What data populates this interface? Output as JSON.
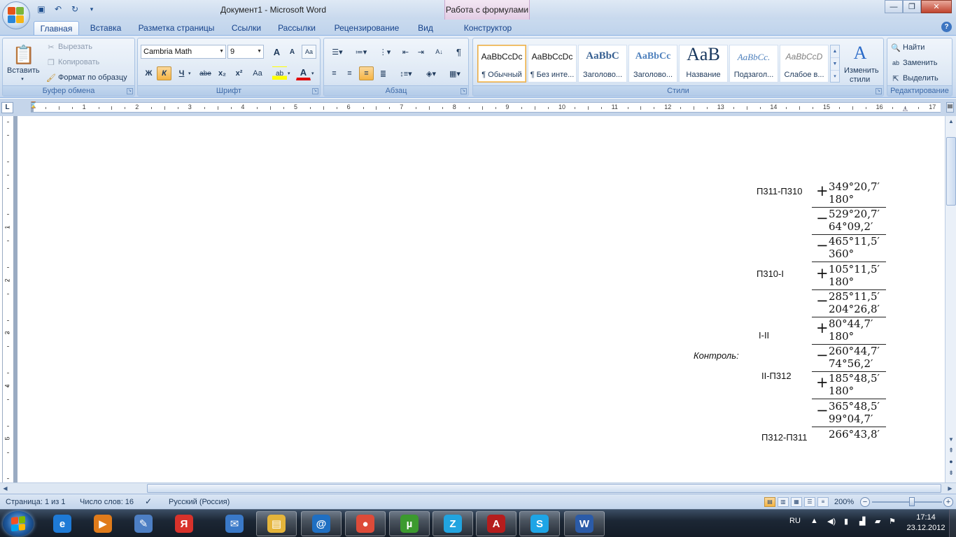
{
  "titlebar": {
    "document_title": "Документ1 - Microsoft Word",
    "context_tab_title": "Работа с формулами",
    "minimize": "—",
    "maximize": "❐",
    "close": "✕"
  },
  "qat": {
    "save_icon": "save-icon",
    "undo_icon": "undo-icon",
    "redo_icon": "redo-icon",
    "customize_icon": "qat-dropdown-icon"
  },
  "tabs": [
    "Главная",
    "Вставка",
    "Разметка страницы",
    "Ссылки",
    "Рассылки",
    "Рецензирование",
    "Вид",
    "Конструктор"
  ],
  "ribbon": {
    "clipboard": {
      "label": "Буфер обмена",
      "paste": "Вставить",
      "cut": "Вырезать",
      "copy": "Копировать",
      "format_painter": "Формат по образцу"
    },
    "font": {
      "label": "Шрифт",
      "font_name": "Cambria Math",
      "font_size": "9",
      "bold": "Ж",
      "italic": "К",
      "underline": "Ч",
      "strike": "abe",
      "subscript": "x₂",
      "superscript": "x²",
      "change_case": "Aa",
      "grow": "A",
      "shrink": "A",
      "highlight": "ab",
      "font_color": "A"
    },
    "paragraph": {
      "label": "Абзац"
    },
    "styles": {
      "label": "Стили",
      "items": [
        {
          "sample": "AaBbCcDc",
          "name": "¶ Обычный"
        },
        {
          "sample": "AaBbCcDc",
          "name": "¶ Без инте..."
        },
        {
          "sample": "AaBbC",
          "name": "Заголово..."
        },
        {
          "sample": "AaBbCc",
          "name": "Заголово..."
        },
        {
          "sample": "AaB",
          "name": "Название"
        },
        {
          "sample": "AaBbCc.",
          "name": "Подзагол..."
        },
        {
          "sample": "AaBbCcD",
          "name": "Слабое в..."
        }
      ],
      "change_styles_1": "Изменить",
      "change_styles_2": "стили"
    },
    "editing": {
      "label": "Редактирование",
      "find": "Найти",
      "replace": "Заменить",
      "select": "Выделить"
    }
  },
  "ruler": {
    "corner": "L",
    "numbers": [
      "1",
      "2",
      "3",
      "4",
      "5",
      "6",
      "7",
      "8",
      "9",
      "10",
      "11",
      "12",
      "13",
      "14",
      "15",
      "16",
      "17"
    ],
    "vnumbers": [
      "1",
      "2",
      "3",
      "4",
      "5"
    ]
  },
  "document": {
    "labels": {
      "p311_p310": "П311-П310",
      "p310_i": "П310-I",
      "i_ii": "I-II",
      "kontrol": "Контроль:",
      "ii_p312": "II-П312",
      "p312_p311": "П312-П311"
    },
    "calc": [
      {
        "op": "+",
        "top": "349°20,7′",
        "bottom": "180°"
      },
      {
        "op": "−",
        "top": "529°20,7′",
        "bottom": "64°09,2′"
      },
      {
        "op": "−",
        "top": "465°11,5′",
        "bottom": "360°"
      },
      {
        "op": "+",
        "top": "105°11,5′",
        "bottom": "180°"
      },
      {
        "op": "−",
        "top": "285°11,5′",
        "bottom": "204°26,8′"
      },
      {
        "op": "+",
        "top": "80°44,7′",
        "bottom": "180°"
      },
      {
        "op": "−",
        "top": "260°44,7′",
        "bottom": "74°56,2′"
      },
      {
        "op": "+",
        "top": "185°48,5′",
        "bottom": "180°"
      },
      {
        "op": "−",
        "top": "365°48,5′",
        "bottom": "99°04,7′"
      }
    ],
    "result": "266°43,8′"
  },
  "statusbar": {
    "page": "Страница: 1 из 1",
    "words": "Число слов: 16",
    "language": "Русский (Россия)",
    "zoom": "200%",
    "zoom_minus": "−",
    "zoom_plus": "+"
  },
  "taskbar": {
    "lang": "RU",
    "time": "17:14",
    "date": "23.12.2012",
    "apps": [
      {
        "name": "ie-icon",
        "glyph": "e",
        "color": "#1e7ad6"
      },
      {
        "name": "media-player-icon",
        "glyph": "▶",
        "color": "#e07b1a"
      },
      {
        "name": "paint-icon",
        "glyph": "✎",
        "color": "#4d7fc4"
      },
      {
        "name": "yandex-icon",
        "glyph": "Я",
        "color": "#d8322b"
      },
      {
        "name": "mail-icon",
        "glyph": "✉",
        "color": "#3a79c8"
      },
      {
        "name": "explorer-icon",
        "glyph": "▤",
        "color": "#e5b53b"
      },
      {
        "name": "mail-agent-icon",
        "glyph": "@",
        "color": "#1f6fc2"
      },
      {
        "name": "chrome-icon",
        "glyph": "●",
        "color": "#dd4b39"
      },
      {
        "name": "utorrent-icon",
        "glyph": "µ",
        "color": "#3c9a2f"
      },
      {
        "name": "zona-icon",
        "glyph": "Z",
        "color": "#21a4e0"
      },
      {
        "name": "acrobat-icon",
        "glyph": "A",
        "color": "#b51d1d"
      },
      {
        "name": "skype-icon",
        "glyph": "S",
        "color": "#1ea5e6"
      },
      {
        "name": "word-icon",
        "glyph": "W",
        "color": "#2b5ba8"
      }
    ]
  }
}
